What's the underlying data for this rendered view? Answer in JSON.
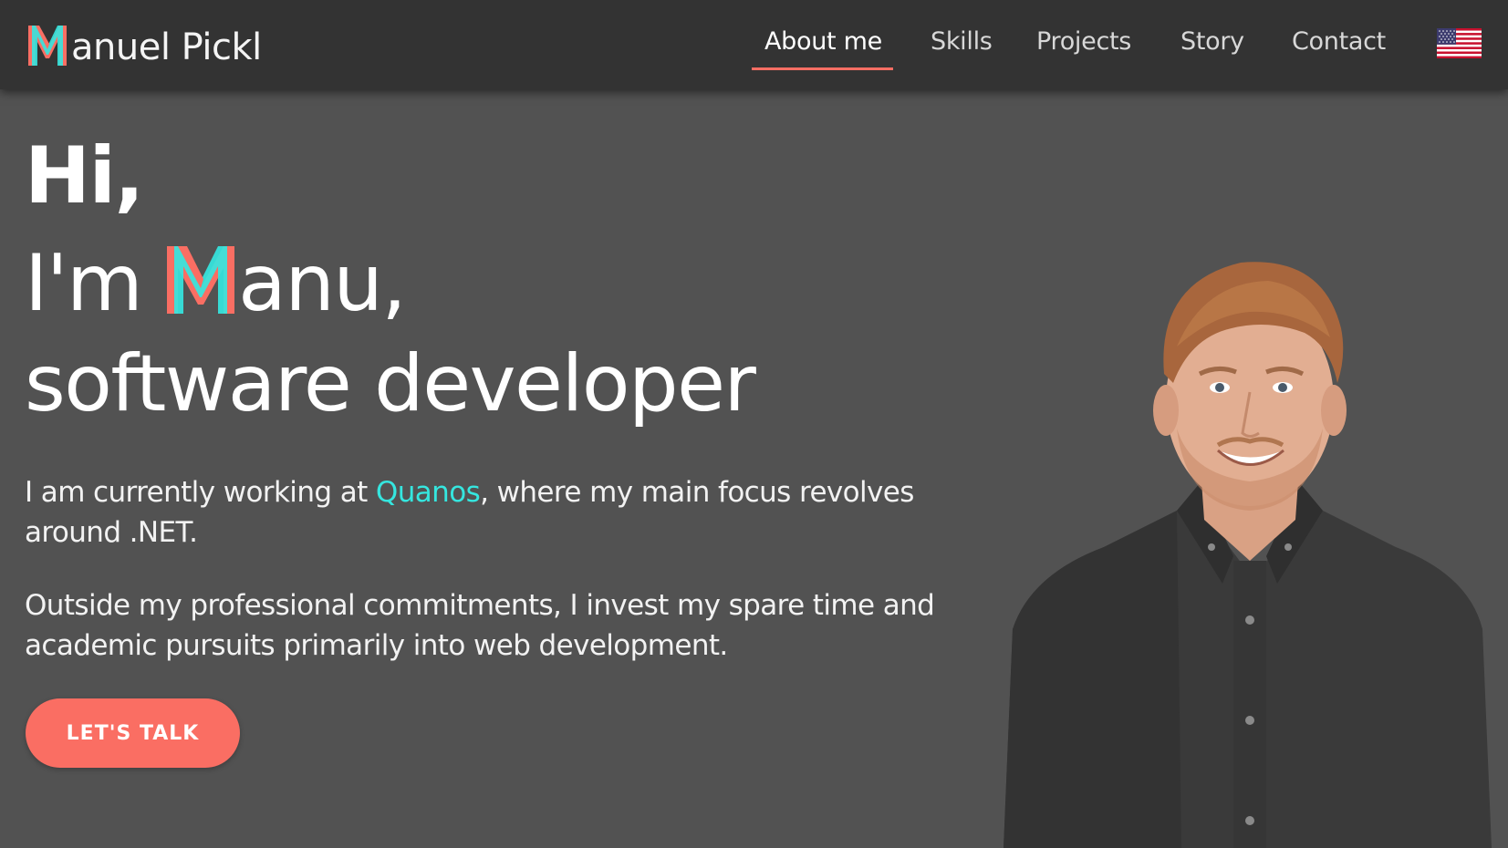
{
  "header": {
    "logo_text": "anuel Pickl",
    "logo_alt": "M",
    "nav": [
      {
        "label": "About me",
        "active": true
      },
      {
        "label": "Skills",
        "active": false
      },
      {
        "label": "Projects",
        "active": false
      },
      {
        "label": "Story",
        "active": false
      },
      {
        "label": "Contact",
        "active": false
      }
    ],
    "language_flag": "us-flag-icon"
  },
  "hero": {
    "line1": "Hi,",
    "line2_prefix": "I'm ",
    "line2_m": "M",
    "line2_rest": "anu,",
    "line3": "software developer"
  },
  "intro": {
    "p1_before": "I am currently working at ",
    "p1_link": "Quanos",
    "p1_after": ", where my main focus revolves around .NET.",
    "p2": "Outside my professional commitments, I invest my spare time and academic pursuits primarily into web development."
  },
  "cta": {
    "label": "LET'S TALK"
  },
  "colors": {
    "background": "#525252",
    "navbar": "#333333",
    "accent_coral": "#fa6e63",
    "accent_cyan": "#35e6df",
    "text": "#ffffff"
  }
}
